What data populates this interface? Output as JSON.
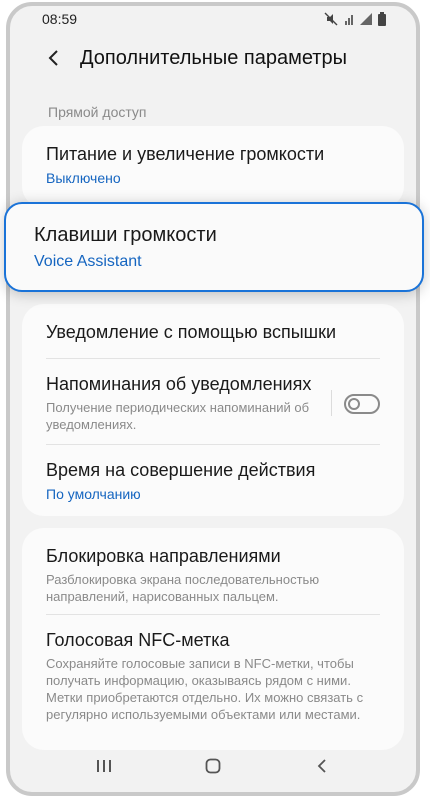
{
  "status_bar": {
    "time": "08:59",
    "icons": [
      "mute-icon",
      "wifi-icon",
      "signal-icon",
      "battery-icon"
    ]
  },
  "header": {
    "title": "Дополнительные параметры"
  },
  "section": {
    "label": "Прямой доступ"
  },
  "items": [
    {
      "title": "Питание и увеличение громкости",
      "subtitle": "Выключено"
    },
    {
      "title": "Клавиши громкости",
      "subtitle": "Voice Assistant"
    },
    {
      "title": "Уведомление с помощью вспышки"
    },
    {
      "title": "Напоминания об уведомлениях",
      "subtitle": "Получение периодических напоминаний об уведомлениях.",
      "toggle": "off"
    },
    {
      "title": "Время на совершение действия",
      "subtitle": "По умолчанию"
    },
    {
      "title": "Блокировка направлениями",
      "subtitle": "Разблокировка экрана последовательностью направлений, нарисованных пальцем."
    },
    {
      "title": "Голосовая NFC-метка",
      "subtitle": "Сохраняйте голосовые записи в NFC-метки, чтобы получать информацию, оказываясь рядом с ними. Метки приобретаются отдельно. Их можно связать с регулярно используемыми объектами или местами."
    }
  ],
  "colors": {
    "accent_blue": "#1565c0",
    "highlight_border": "#1a73d8"
  },
  "nav_bar": {
    "icons": [
      "recent-apps-icon",
      "home-icon",
      "back-icon"
    ]
  }
}
